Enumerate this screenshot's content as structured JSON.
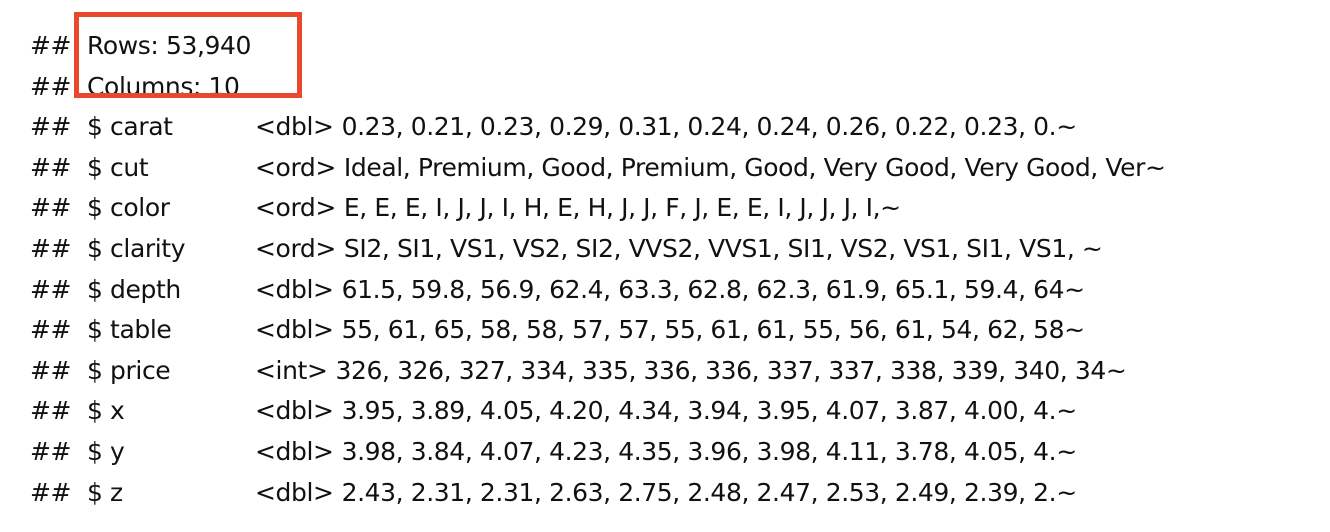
{
  "highlight_color": "#e8482c",
  "header": [
    {
      "prefix": "##",
      "text": "Rows: 53,940"
    },
    {
      "prefix": "##",
      "text": "Columns: 10"
    }
  ],
  "columns": [
    {
      "prefix": "##",
      "name": "$ carat",
      "type": "<dbl>",
      "values": "0.23, 0.21, 0.23, 0.29, 0.31, 0.24, 0.24, 0.26, 0.22, 0.23, 0.~"
    },
    {
      "prefix": "##",
      "name": "$ cut",
      "type": "<ord>",
      "values": "Ideal, Premium, Good, Premium, Good, Very Good, Very Good, Ver~"
    },
    {
      "prefix": "##",
      "name": "$ color",
      "type": "<ord>",
      "values": "E, E, E, I, J, J, I, H, E, H, J, J, F, J, E, E, I, J, J, J, I,~"
    },
    {
      "prefix": "##",
      "name": "$ clarity",
      "type": "<ord>",
      "values": "SI2, SI1, VS1, VS2, SI2, VVS2, VVS1, SI1, VS2, VS1, SI1, VS1, ~"
    },
    {
      "prefix": "##",
      "name": "$ depth",
      "type": "<dbl>",
      "values": "61.5, 59.8, 56.9, 62.4, 63.3, 62.8, 62.3, 61.9, 65.1, 59.4, 64~"
    },
    {
      "prefix": "##",
      "name": "$ table",
      "type": "<dbl>",
      "values": "55, 61, 65, 58, 58, 57, 57, 55, 61, 61, 55, 56, 61, 54, 62, 58~"
    },
    {
      "prefix": "##",
      "name": "$ price",
      "type": "<int>",
      "values": "326, 326, 327, 334, 335, 336, 336, 337, 337, 338, 339, 340, 34~"
    },
    {
      "prefix": "##",
      "name": "$ x",
      "type": "<dbl>",
      "values": "3.95, 3.89, 4.05, 4.20, 4.34, 3.94, 3.95, 4.07, 3.87, 4.00, 4.~"
    },
    {
      "prefix": "##",
      "name": "$ y",
      "type": "<dbl>",
      "values": "3.98, 3.84, 4.07, 4.23, 4.35, 3.96, 3.98, 4.11, 3.78, 4.05, 4.~"
    },
    {
      "prefix": "##",
      "name": "$ z",
      "type": "<dbl>",
      "values": "2.43, 2.31, 2.31, 2.63, 2.75, 2.48, 2.47, 2.53, 2.49, 2.39, 2.~"
    }
  ]
}
